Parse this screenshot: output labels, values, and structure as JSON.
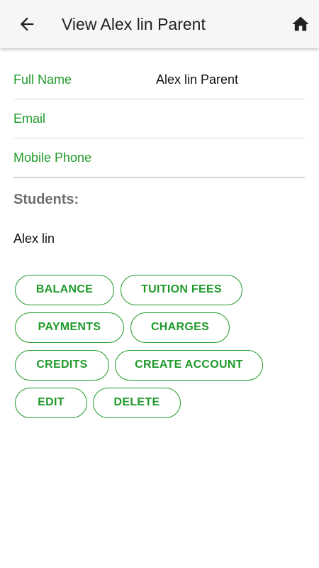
{
  "header": {
    "title": "View Alex lin Parent",
    "back_icon": "arrow-left-icon",
    "home_icon": "home-icon"
  },
  "details": {
    "full_name": {
      "label": "Full Name",
      "value": "Alex lin Parent"
    },
    "email": {
      "label": "Email",
      "value": ""
    },
    "mobile_phone": {
      "label": "Mobile Phone",
      "value": ""
    }
  },
  "students": {
    "heading": "Students:",
    "items": [
      "Alex lin"
    ]
  },
  "actions": {
    "balance": "BALANCE",
    "tuition_fees": "TUITION FEES",
    "payments": "PAYMENTS",
    "charges": "CHARGES",
    "credits": "CREDITS",
    "create_account": "CREATE ACCOUNT",
    "edit": "EDIT",
    "delete": "DELETE"
  },
  "colors": {
    "accent": "#1f9a2a",
    "heading_gray": "#6f6f6f",
    "appbar_bg": "#f6f6f6"
  }
}
